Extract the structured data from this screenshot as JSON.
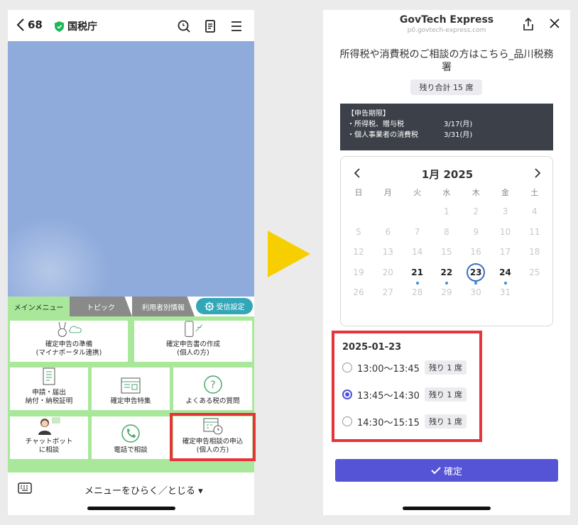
{
  "left": {
    "header": {
      "back_count": "68",
      "account_name": "国税庁"
    },
    "tabs": [
      "メインメニュー",
      "トピック",
      "利用者別情報",
      "受信設定"
    ],
    "menu": {
      "prep": "確定申告の準備\n(マイナポータル連携)",
      "create": "確定申告書の作成\n(個人の方)",
      "apply": "申請・届出\n納付・納税証明",
      "special": "確定申告特集",
      "faq": "よくある税の質問",
      "chatbot": "チャットボット\nに相談",
      "phone": "電話で相談",
      "consult": "確定申告相談の申込\n(個人の方)"
    },
    "footer": {
      "menu_toggle": "メニューをひらく／とじる ▾"
    }
  },
  "right": {
    "app_title": "GovTech Express",
    "app_url": "p0.govtech-express.com",
    "heading": "所得税や消費税のご相談の方はこちら_品川税務署",
    "seats_total": "残り合計 15 席",
    "deadline": {
      "title": "【申告期限】",
      "rows": [
        {
          "label": "・所得税、贈与税",
          "date": "3/17(月)"
        },
        {
          "label": "・個人事業者の消費税",
          "date": "3/31(月)"
        }
      ]
    },
    "calendar": {
      "month": "1月 2025",
      "weekdays": [
        "日",
        "月",
        "火",
        "水",
        "木",
        "金",
        "土"
      ],
      "weeks": [
        [
          "",
          "",
          "",
          "1",
          "2",
          "3",
          "4"
        ],
        [
          "5",
          "6",
          "7",
          "8",
          "9",
          "10",
          "11"
        ],
        [
          "12",
          "13",
          "14",
          "15",
          "16",
          "17",
          "18"
        ],
        [
          "19",
          "20",
          "21",
          "22",
          "23",
          "24",
          "25"
        ],
        [
          "26",
          "27",
          "28",
          "29",
          "30",
          "31",
          ""
        ]
      ],
      "available": [
        "21",
        "22",
        "23",
        "24"
      ],
      "selected": "23"
    },
    "slots": {
      "date": "2025-01-23",
      "items": [
        {
          "time": "13:00〜13:45",
          "remaining": "残り 1 席",
          "selected": false
        },
        {
          "time": "13:45〜14:30",
          "remaining": "残り 1 席",
          "selected": true
        },
        {
          "time": "14:30〜15:15",
          "remaining": "残り 1 席",
          "selected": false
        }
      ]
    },
    "confirm_label": "確定"
  },
  "colors": {
    "accent": "#5553d6",
    "highlight": "#e8333a",
    "arrow": "#f7cf00",
    "menu_green": "#a9e89a"
  }
}
